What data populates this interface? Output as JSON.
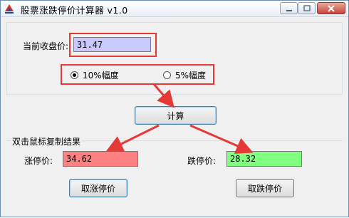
{
  "window": {
    "title": "股票涨跌停价计算器 v1.0"
  },
  "input": {
    "label": "当前收盘价:",
    "value": "31.47"
  },
  "options": [
    {
      "label": "10%幅度",
      "checked": true
    },
    {
      "label": "5%幅度",
      "checked": false
    }
  ],
  "calc_button": "计算",
  "results": {
    "group_title": "双击鼠标复制结果",
    "up_label": "涨停价:",
    "up_value": "34.62",
    "down_label": "跌停价:",
    "down_value": "28.32",
    "cancel_up_button": "取涨停价",
    "cancel_down_button": "取跌停价"
  },
  "colors": {
    "annotation_red": "#e53935",
    "price_bg": "#c9c8ff",
    "up_bg": "#ff8080",
    "down_bg": "#80ff80"
  }
}
